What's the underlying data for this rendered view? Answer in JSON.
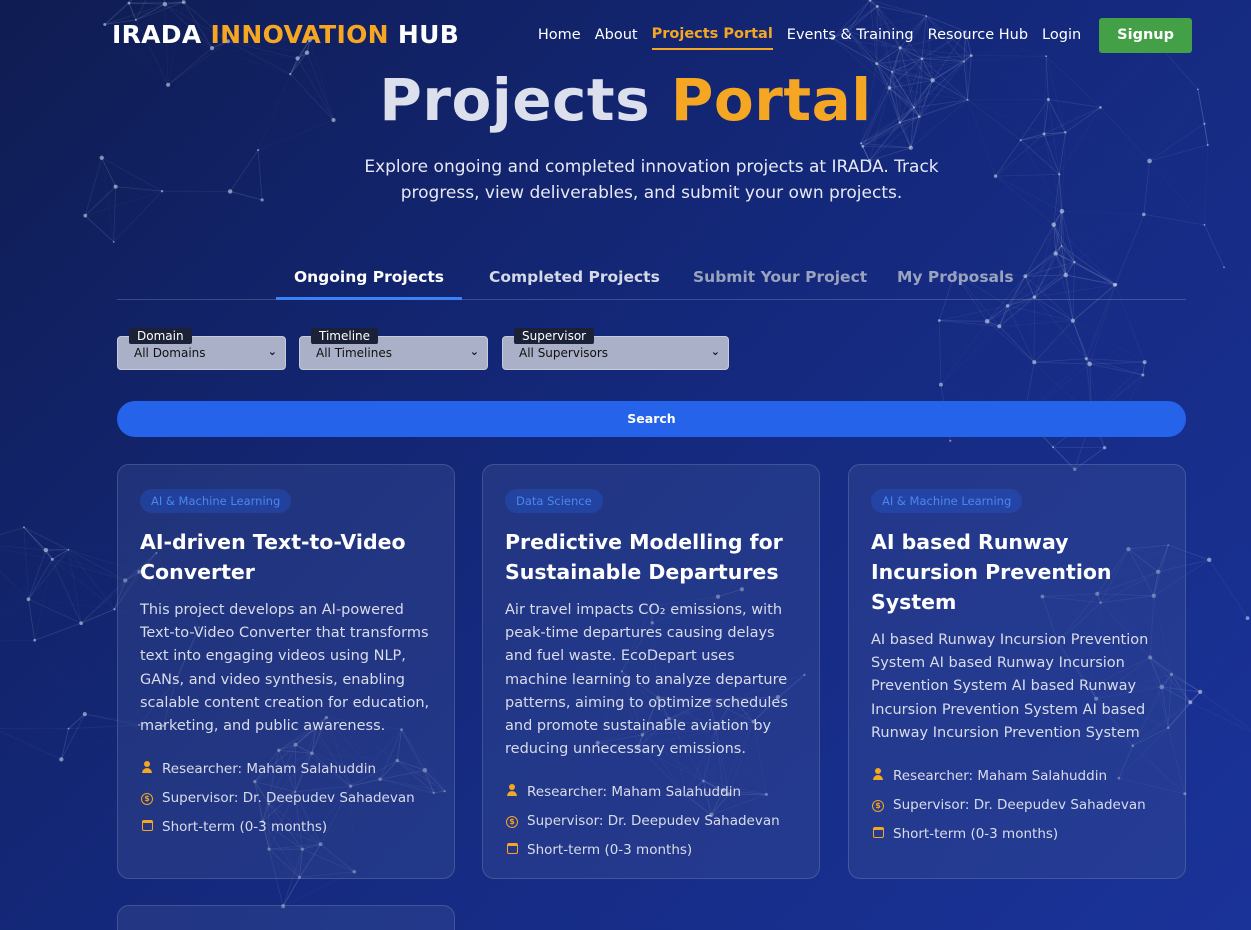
{
  "brand": {
    "part1": "IRADA",
    "part2": "INNOVATION",
    "part3": "HUB"
  },
  "nav": {
    "items": [
      {
        "label": "Home"
      },
      {
        "label": "About"
      },
      {
        "label": "Projects Portal"
      },
      {
        "label": "Events & Training"
      },
      {
        "label": "Resource Hub"
      },
      {
        "label": "Login"
      }
    ],
    "signup": "Signup"
  },
  "hero": {
    "title_part1": "Projects",
    "title_part2": "Portal",
    "subtitle": "Explore ongoing and completed innovation projects at IRADA. Track progress, view deliverables, and submit your own projects."
  },
  "tabs": [
    {
      "label": "Ongoing Projects",
      "active": true
    },
    {
      "label": "Completed Projects"
    },
    {
      "label": "Submit Your Project"
    },
    {
      "label": "My Proposals"
    }
  ],
  "filters": {
    "domain": {
      "label": "Domain",
      "value": "All Domains"
    },
    "timeline": {
      "label": "Timeline",
      "value": "All Timelines"
    },
    "supervisor": {
      "label": "Supervisor",
      "value": "All Supervisors"
    }
  },
  "search_label": "Search",
  "projects": [
    {
      "tag": "AI & Machine Learning",
      "title": "AI-driven Text-to-Video Converter",
      "description": "This project develops an AI-powered Text-to-Video Converter that transforms text into engaging videos using NLP, GANs, and video synthesis, enabling scalable content creation for education, marketing, and public awareness.",
      "researcher": "Researcher: Maham Salahuddin",
      "supervisor": "Supervisor: Dr. Deepudev Sahadevan",
      "duration": "Short-term (0-3 months)"
    },
    {
      "tag": "Data Science",
      "title": "Predictive Modelling for Sustainable Departures",
      "description": "Air travel impacts CO₂ emissions, with peak-time departures causing delays and fuel waste. EcoDepart uses machine learning to analyze departure patterns, aiming to optimize schedules and promote sustainable aviation by reducing unnecessary emissions.",
      "researcher": "Researcher: Maham Salahuddin",
      "supervisor": "Supervisor: Dr. Deepudev Sahadevan",
      "duration": "Short-term (0-3 months)"
    },
    {
      "tag": "AI & Machine Learning",
      "title": "AI based Runway Incursion Prevention System",
      "description": "AI based Runway Incursion Prevention System AI based Runway Incursion Prevention System AI based Runway Incursion Prevention System AI based Runway Incursion Prevention System",
      "researcher": "Researcher: Maham Salahuddin",
      "supervisor": "Supervisor: Dr. Deepudev Sahadevan",
      "duration": "Short-term (0-3 months)"
    }
  ],
  "colors": {
    "accent": "#f5a623",
    "primary": "#2563eb",
    "signup": "#43a047"
  },
  "icons": {
    "researcher": "user-icon",
    "supervisor": "coin-icon",
    "duration": "calendar-icon",
    "select": "chevron-down-icon"
  }
}
